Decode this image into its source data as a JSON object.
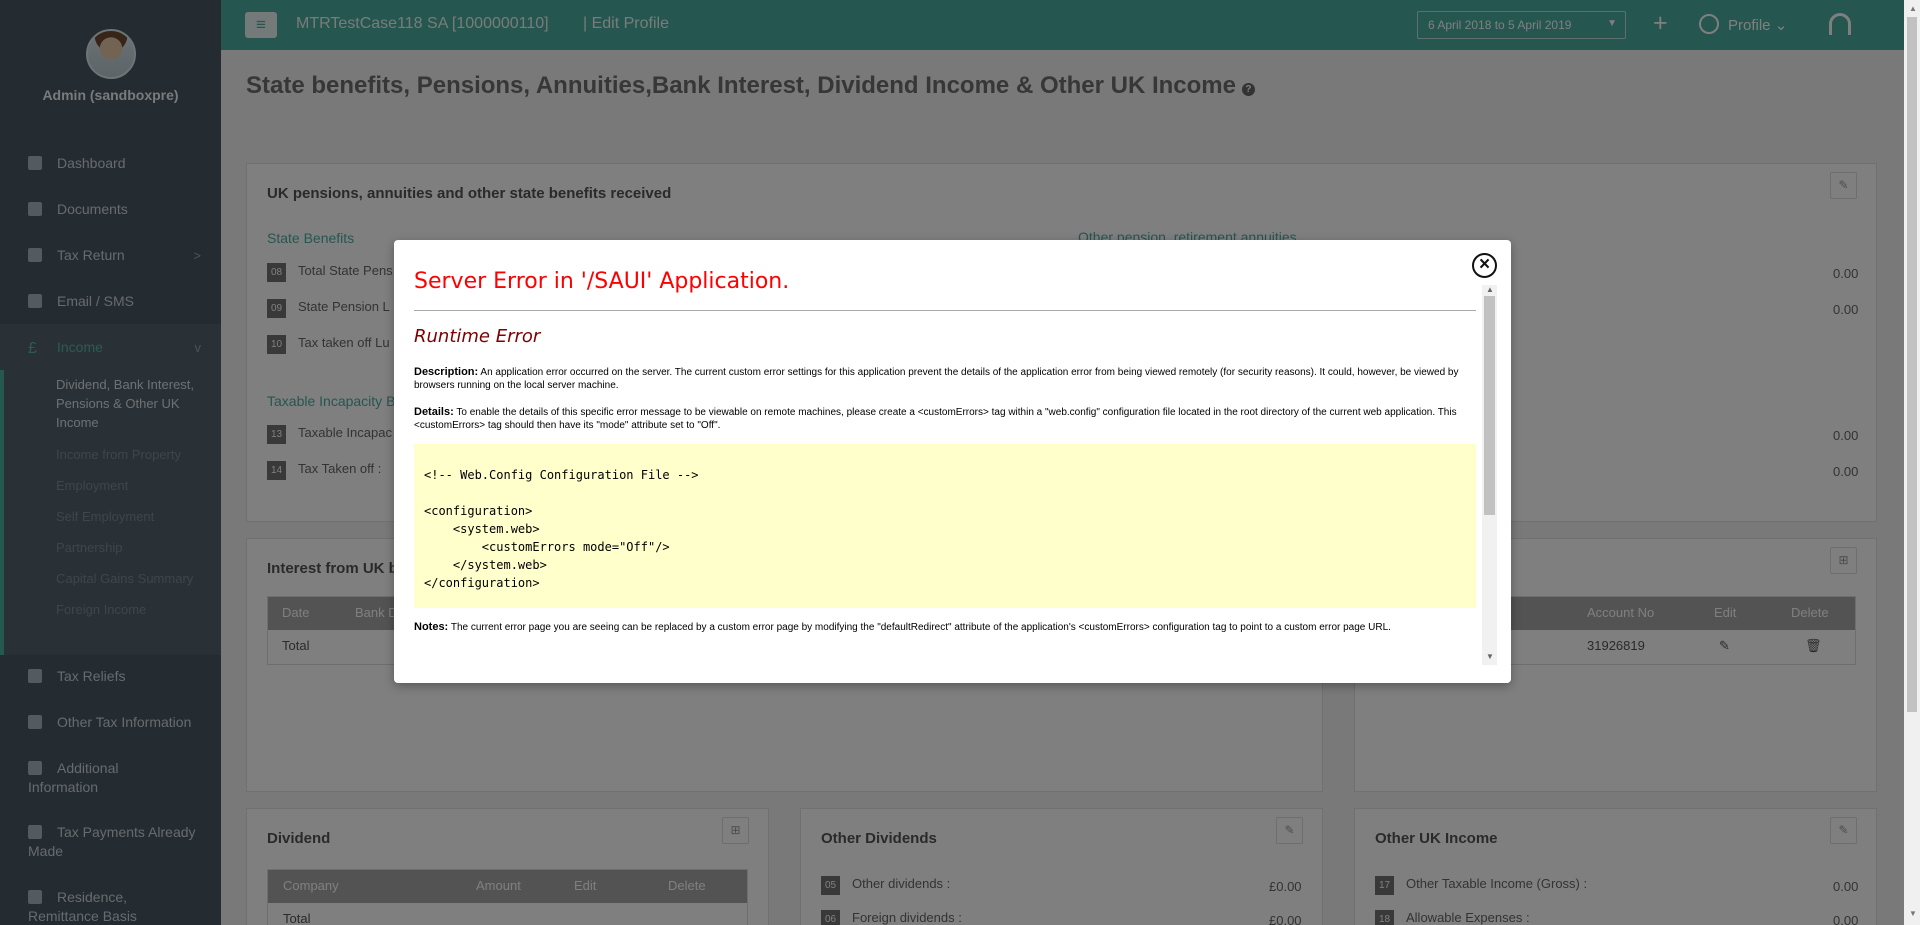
{
  "sidebar": {
    "username": "Admin (sandboxpre)",
    "nav": [
      {
        "label": "Dashboard"
      },
      {
        "label": "Documents"
      },
      {
        "label": "Tax Return"
      },
      {
        "label": "Email / SMS"
      },
      {
        "label": "Income",
        "icon": "£"
      }
    ],
    "income_sub": [
      {
        "label": "Dividend, Bank Interest, Pensions & Other UK Income"
      },
      {
        "label": "Income from Property"
      },
      {
        "label": "Employment"
      },
      {
        "label": "Self Employment"
      },
      {
        "label": "Partnership"
      },
      {
        "label": "Capital Gains Summary"
      },
      {
        "label": "Foreign Income"
      }
    ],
    "lower": [
      {
        "label": "Tax Reliefs"
      },
      {
        "label": "Other Tax Information"
      },
      {
        "label": "Additional Information"
      },
      {
        "label": "Tax Payments Already Made"
      },
      {
        "label": "Residence, Remittance Basis"
      }
    ]
  },
  "topbar": {
    "client": "MTRTestCase118 SA [1000000110]",
    "page": "| Edit Profile",
    "date_range": "6 April 2018 to 5 April 2019",
    "profile": "Profile"
  },
  "page_title": "State benefits, Pensions, Annuities,Bank Interest, Dividend Income & Other UK Income",
  "pensions": {
    "title": "UK pensions, annuities and other state benefits received",
    "state_benefits": "State Benefits",
    "other_pension": "Other pension, retirement annuities",
    "rows": [
      {
        "num": "08",
        "label": "Total State Pens",
        "value": "0.00"
      },
      {
        "num": "09",
        "label": "State Pension L",
        "value": "0.00"
      },
      {
        "num": "10",
        "label": "Tax taken off Lu"
      }
    ],
    "taxable_incapacity": "Taxable Incapacity B",
    "rows2": [
      {
        "num": "13",
        "label": "Taxable Incapac",
        "value": "0.00"
      },
      {
        "num": "14",
        "label": "Tax Taken off :",
        "value": "0.00"
      }
    ]
  },
  "interest": {
    "title": "Interest from UK ba",
    "headers": [
      "Date",
      "Bank D"
    ],
    "total": "Total",
    "right_headers": [
      "Account No",
      "Edit",
      "Delete"
    ],
    "account_no": "31926819"
  },
  "dividend": {
    "title": "Dividend",
    "headers": [
      "Company",
      "Amount",
      "Edit",
      "Delete"
    ],
    "total": "Total"
  },
  "other_dividends": {
    "title": "Other Dividends",
    "rows": [
      {
        "num": "05",
        "label": "Other dividends :",
        "value": "£0.00"
      },
      {
        "num": "06",
        "label": "Foreign dividends :",
        "value": "£0.00"
      }
    ]
  },
  "other_uk": {
    "title": "Other UK Income",
    "rows": [
      {
        "num": "17",
        "label": "Other Taxable Income (Gross) :",
        "value": "0.00"
      },
      {
        "num": "18",
        "label": "Allowable Expenses :",
        "value": "0.00"
      }
    ]
  },
  "modal": {
    "title": "Server Error in '/SAUI' Application.",
    "subtitle": "Runtime Error",
    "description_label": "Description:",
    "description": "An application error occurred on the server. The current custom error settings for this application prevent the details of the application error from being viewed remotely (for security reasons). It could, however, be viewed by browsers running on the local server machine.",
    "details_label": "Details:",
    "details": "To enable the details of this specific error message to be viewable on remote machines, please create a <customErrors> tag within a \"web.config\" configuration file located in the root directory of the current web application. This <customErrors> tag should then have its \"mode\" attribute set to \"Off\".",
    "code": "<!-- Web.Config Configuration File -->\n\n<configuration>\n    <system.web>\n        <customErrors mode=\"Off\"/>\n    </system.web>\n</configuration>",
    "notes_label": "Notes:",
    "notes": "The current error page you are seeing can be replaced by a custom error page by modifying the \"defaultRedirect\" attribute of the application's <customErrors> configuration tag to point to a custom error page URL."
  }
}
